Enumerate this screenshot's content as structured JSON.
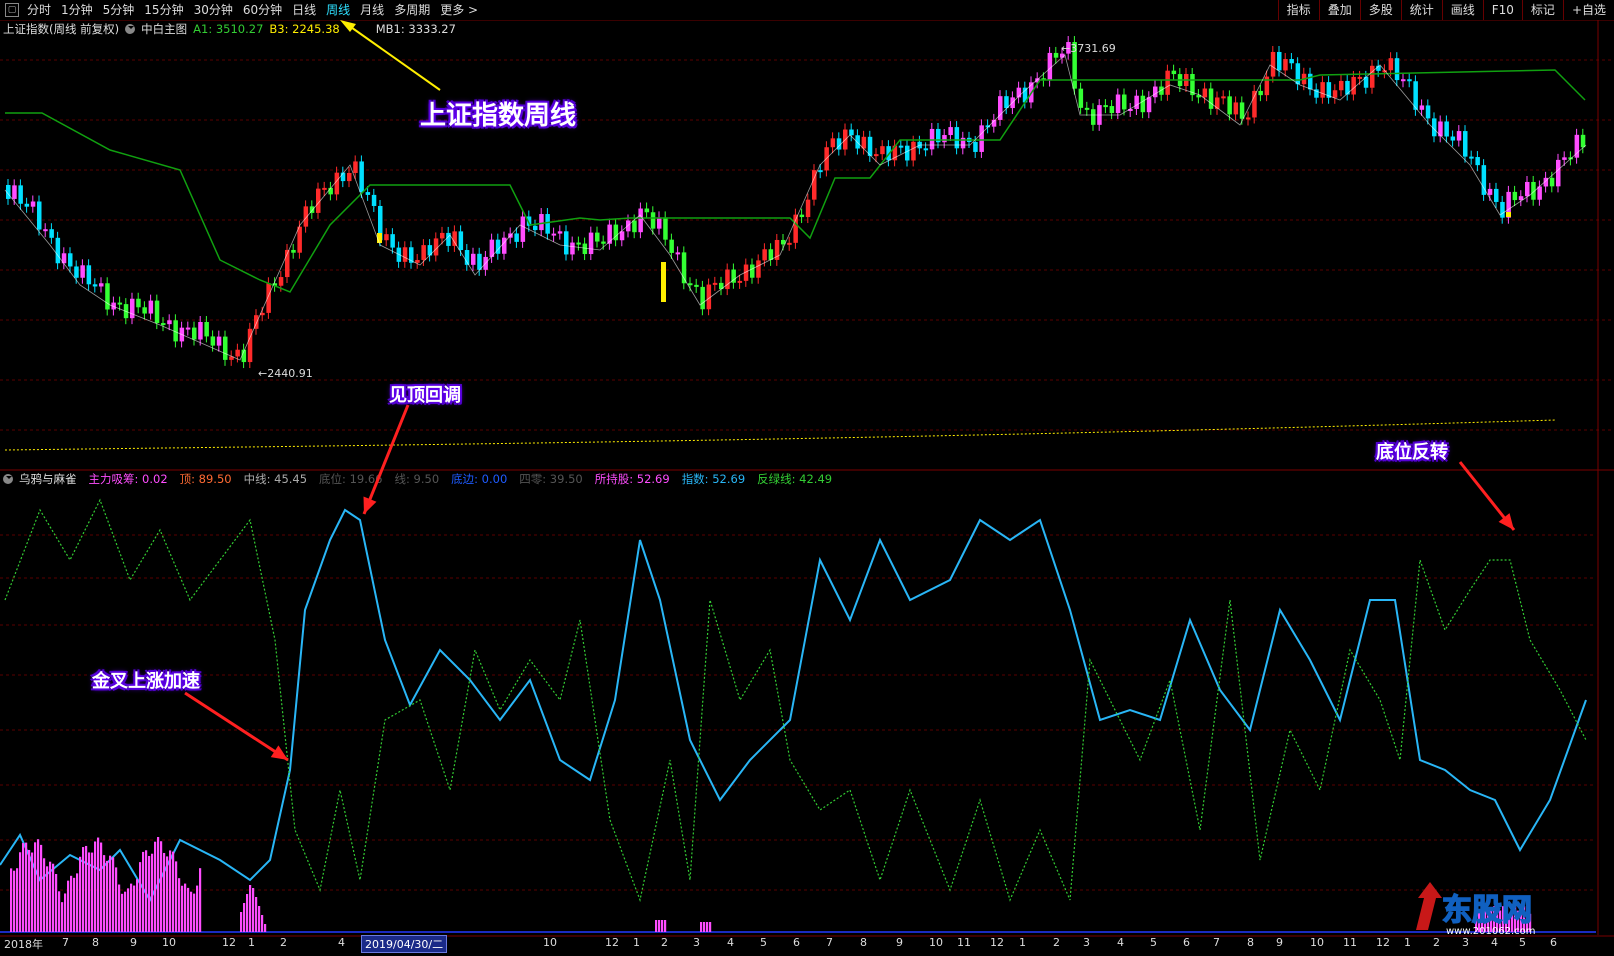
{
  "toolbar": {
    "tabs": [
      "分时",
      "1分钟",
      "5分钟",
      "15分钟",
      "30分钟",
      "60分钟",
      "日线",
      "周线",
      "月线",
      "多周期",
      "更多 >"
    ],
    "active_tab": "周线",
    "right_buttons": [
      "指标",
      "叠加",
      "多股",
      "统计",
      "画线",
      "F10",
      "标记",
      "+自选"
    ]
  },
  "main_info": {
    "title": "上证指数(周线 前复权)",
    "indicator": "中白主图",
    "a1": "A1: 3510.27",
    "b3": "B3: 2245.38",
    "mb1": "MB1: 3333.27"
  },
  "price_labels": {
    "high": "3731.69",
    "low": "2440.91"
  },
  "sub_info": {
    "title": "乌鸦与麻雀",
    "items": [
      {
        "text": "主力吸筹: 0.02",
        "color": "#ff4dff"
      },
      {
        "text": "顶: 89.50",
        "color": "#ff6a33"
      },
      {
        "text": "中线: 45.45",
        "color": "#aaaaaa"
      },
      {
        "text": "底位: 19.66",
        "color": "#555555"
      },
      {
        "text": "线: 9.50",
        "color": "#555555"
      },
      {
        "text": "底边: 0.00",
        "color": "#1e5bff"
      },
      {
        "text": "四零: 39.50",
        "color": "#555555"
      },
      {
        "text": "所持股: 52.69",
        "color": "#ff4dff"
      },
      {
        "text": "指数: 52.69",
        "color": "#29b6f6"
      },
      {
        "text": "反绿线: 42.49",
        "color": "#33cc33"
      }
    ]
  },
  "callouts": {
    "weekly": "上证指数周线",
    "top": "见顶回调",
    "golden": "金叉上涨加速",
    "bottom": "底位反转"
  },
  "x_axis": {
    "labels": [
      "2018年",
      "7",
      "8",
      "9",
      "10",
      "12",
      "1",
      "2",
      "4",
      "2019/04/30/二",
      "10",
      "12",
      "1",
      "2",
      "3",
      "4",
      "5",
      "6",
      "7",
      "8",
      "9",
      "10",
      "11",
      "12",
      "1",
      "2",
      "3",
      "4",
      "5",
      "6",
      "7",
      "8",
      "9",
      "10",
      "11",
      "12",
      "1",
      "2",
      "3",
      "4",
      "5",
      "6"
    ]
  },
  "colors": {
    "up": "#ff2a2a",
    "down": "#00e0ff",
    "ma": "#10a010",
    "index_line": "#29b6f6",
    "green_line": "#33cc33",
    "bars": "#ff4dff"
  },
  "watermark": {
    "brand": "东股网",
    "url": "www.201062.com"
  }
}
